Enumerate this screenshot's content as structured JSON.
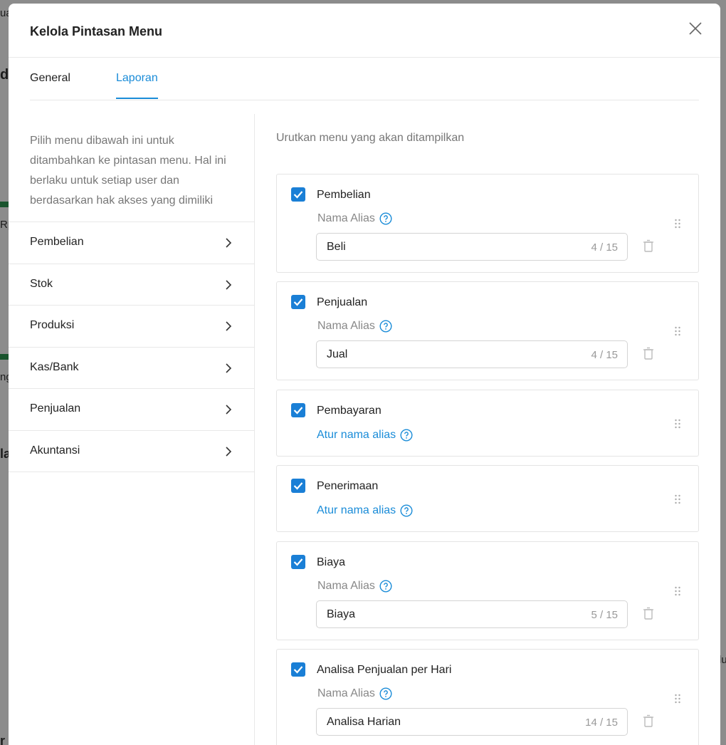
{
  "background": {
    "fragments": [
      "ua",
      "d",
      "Rp",
      "ng",
      "la",
      "r",
      "lu"
    ]
  },
  "modal": {
    "title": "Kelola Pintasan Menu",
    "tabs": [
      {
        "label": "General",
        "active": false
      },
      {
        "label": "Laporan",
        "active": true
      }
    ],
    "left": {
      "description": "Pilih menu dibawah ini untuk ditambahkan ke pintasan menu. Hal ini berlaku untuk setiap user dan berdasarkan hak akses yang dimiliki",
      "items": [
        {
          "label": "Pembelian"
        },
        {
          "label": "Stok"
        },
        {
          "label": "Produksi"
        },
        {
          "label": "Kas/Bank"
        },
        {
          "label": "Penjualan"
        },
        {
          "label": "Akuntansi"
        }
      ]
    },
    "right": {
      "description": "Urutkan menu yang akan ditampilkan",
      "alias_label": "Nama Alias",
      "alias_link": "Atur nama alias",
      "cards": [
        {
          "title": "Pembelian",
          "checked": true,
          "alias": "Beli",
          "count": "4 / 15"
        },
        {
          "title": "Penjualan",
          "checked": true,
          "alias": "Jual",
          "count": "4 / 15"
        },
        {
          "title": "Pembayaran",
          "checked": true,
          "alias": null,
          "count": null
        },
        {
          "title": "Penerimaan",
          "checked": true,
          "alias": null,
          "count": null
        },
        {
          "title": "Biaya",
          "checked": true,
          "alias": "Biaya",
          "count": "5 / 15"
        },
        {
          "title": "Analisa Penjualan per Hari",
          "checked": true,
          "alias": "Analisa Harian",
          "count": "14 / 15"
        }
      ]
    }
  },
  "colors": {
    "accent": "#1a8cd8",
    "checkbox": "#1a7fd6",
    "progress_bar": "#2e9a52"
  }
}
